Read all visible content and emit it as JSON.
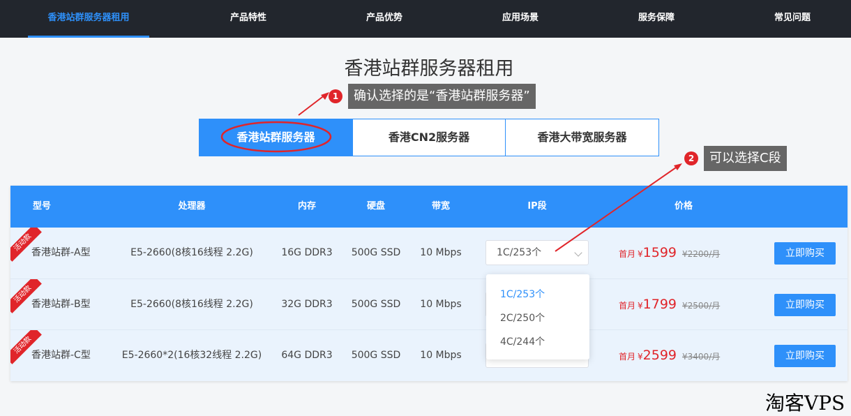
{
  "nav": {
    "items": [
      {
        "label": "香港站群服务器租用",
        "active": true
      },
      {
        "label": "产品特性"
      },
      {
        "label": "产品优势"
      },
      {
        "label": "应用场景"
      },
      {
        "label": "服务保障"
      },
      {
        "label": "常见问题"
      }
    ]
  },
  "page": {
    "title": "香港站群服务器租用"
  },
  "annotations": {
    "step1": {
      "number": "1",
      "text": "确认选择的是“香港站群服务器”"
    },
    "step2": {
      "number": "2",
      "text": "可以选择C段"
    }
  },
  "tabs": [
    {
      "label": "香港站群服务器",
      "active": true
    },
    {
      "label": "香港CN2服务器"
    },
    {
      "label": "香港大带宽服务器"
    }
  ],
  "table": {
    "headers": [
      "型号",
      "处理器",
      "内存",
      "硬盘",
      "带宽",
      "IP段",
      "价格"
    ],
    "rows": [
      {
        "badge": "活动款",
        "model": "香港站群-A型",
        "cpu": "E5-2660(8核16线程 2.2G)",
        "ram": "16G DDR3",
        "disk": "500G SSD",
        "bandwidth": "10 Mbps",
        "ip": "1C/253个",
        "price_prefix": "首月",
        "currency": "¥",
        "price": "1599",
        "old_price": "¥2200/月",
        "buy": "立即购买"
      },
      {
        "badge": "活动款",
        "model": "香港站群-B型",
        "cpu": "E5-2660(8核16线程 2.2G)",
        "ram": "32G DDR3",
        "disk": "500G SSD",
        "bandwidth": "10 Mbps",
        "ip": "",
        "price_prefix": "首月",
        "currency": "¥",
        "price": "1799",
        "old_price": "¥2500/月",
        "buy": "立即购买"
      },
      {
        "badge": "活动款",
        "model": "香港站群-C型",
        "cpu": "E5-2660*2(16核32线程 2.2G)",
        "ram": "64G DDR3",
        "disk": "500G SSD",
        "bandwidth": "10 Mbps",
        "ip": "",
        "price_prefix": "首月",
        "currency": "¥",
        "price": "2599",
        "old_price": "¥3400/月",
        "buy": "立即购买"
      }
    ]
  },
  "ip_dropdown": {
    "options": [
      "1C/253个",
      "2C/250个",
      "4C/244个"
    ],
    "selected": "1C/253个"
  },
  "watermark": "淘客VPS",
  "colors": {
    "accent": "#2e90fa",
    "nav_bg": "#22262d",
    "price_red": "#e0252a",
    "callout_bg": "#666666"
  },
  "icons": {
    "select_arrow": "chevron-down-icon",
    "annotation_arrow": "arrow-icon"
  }
}
